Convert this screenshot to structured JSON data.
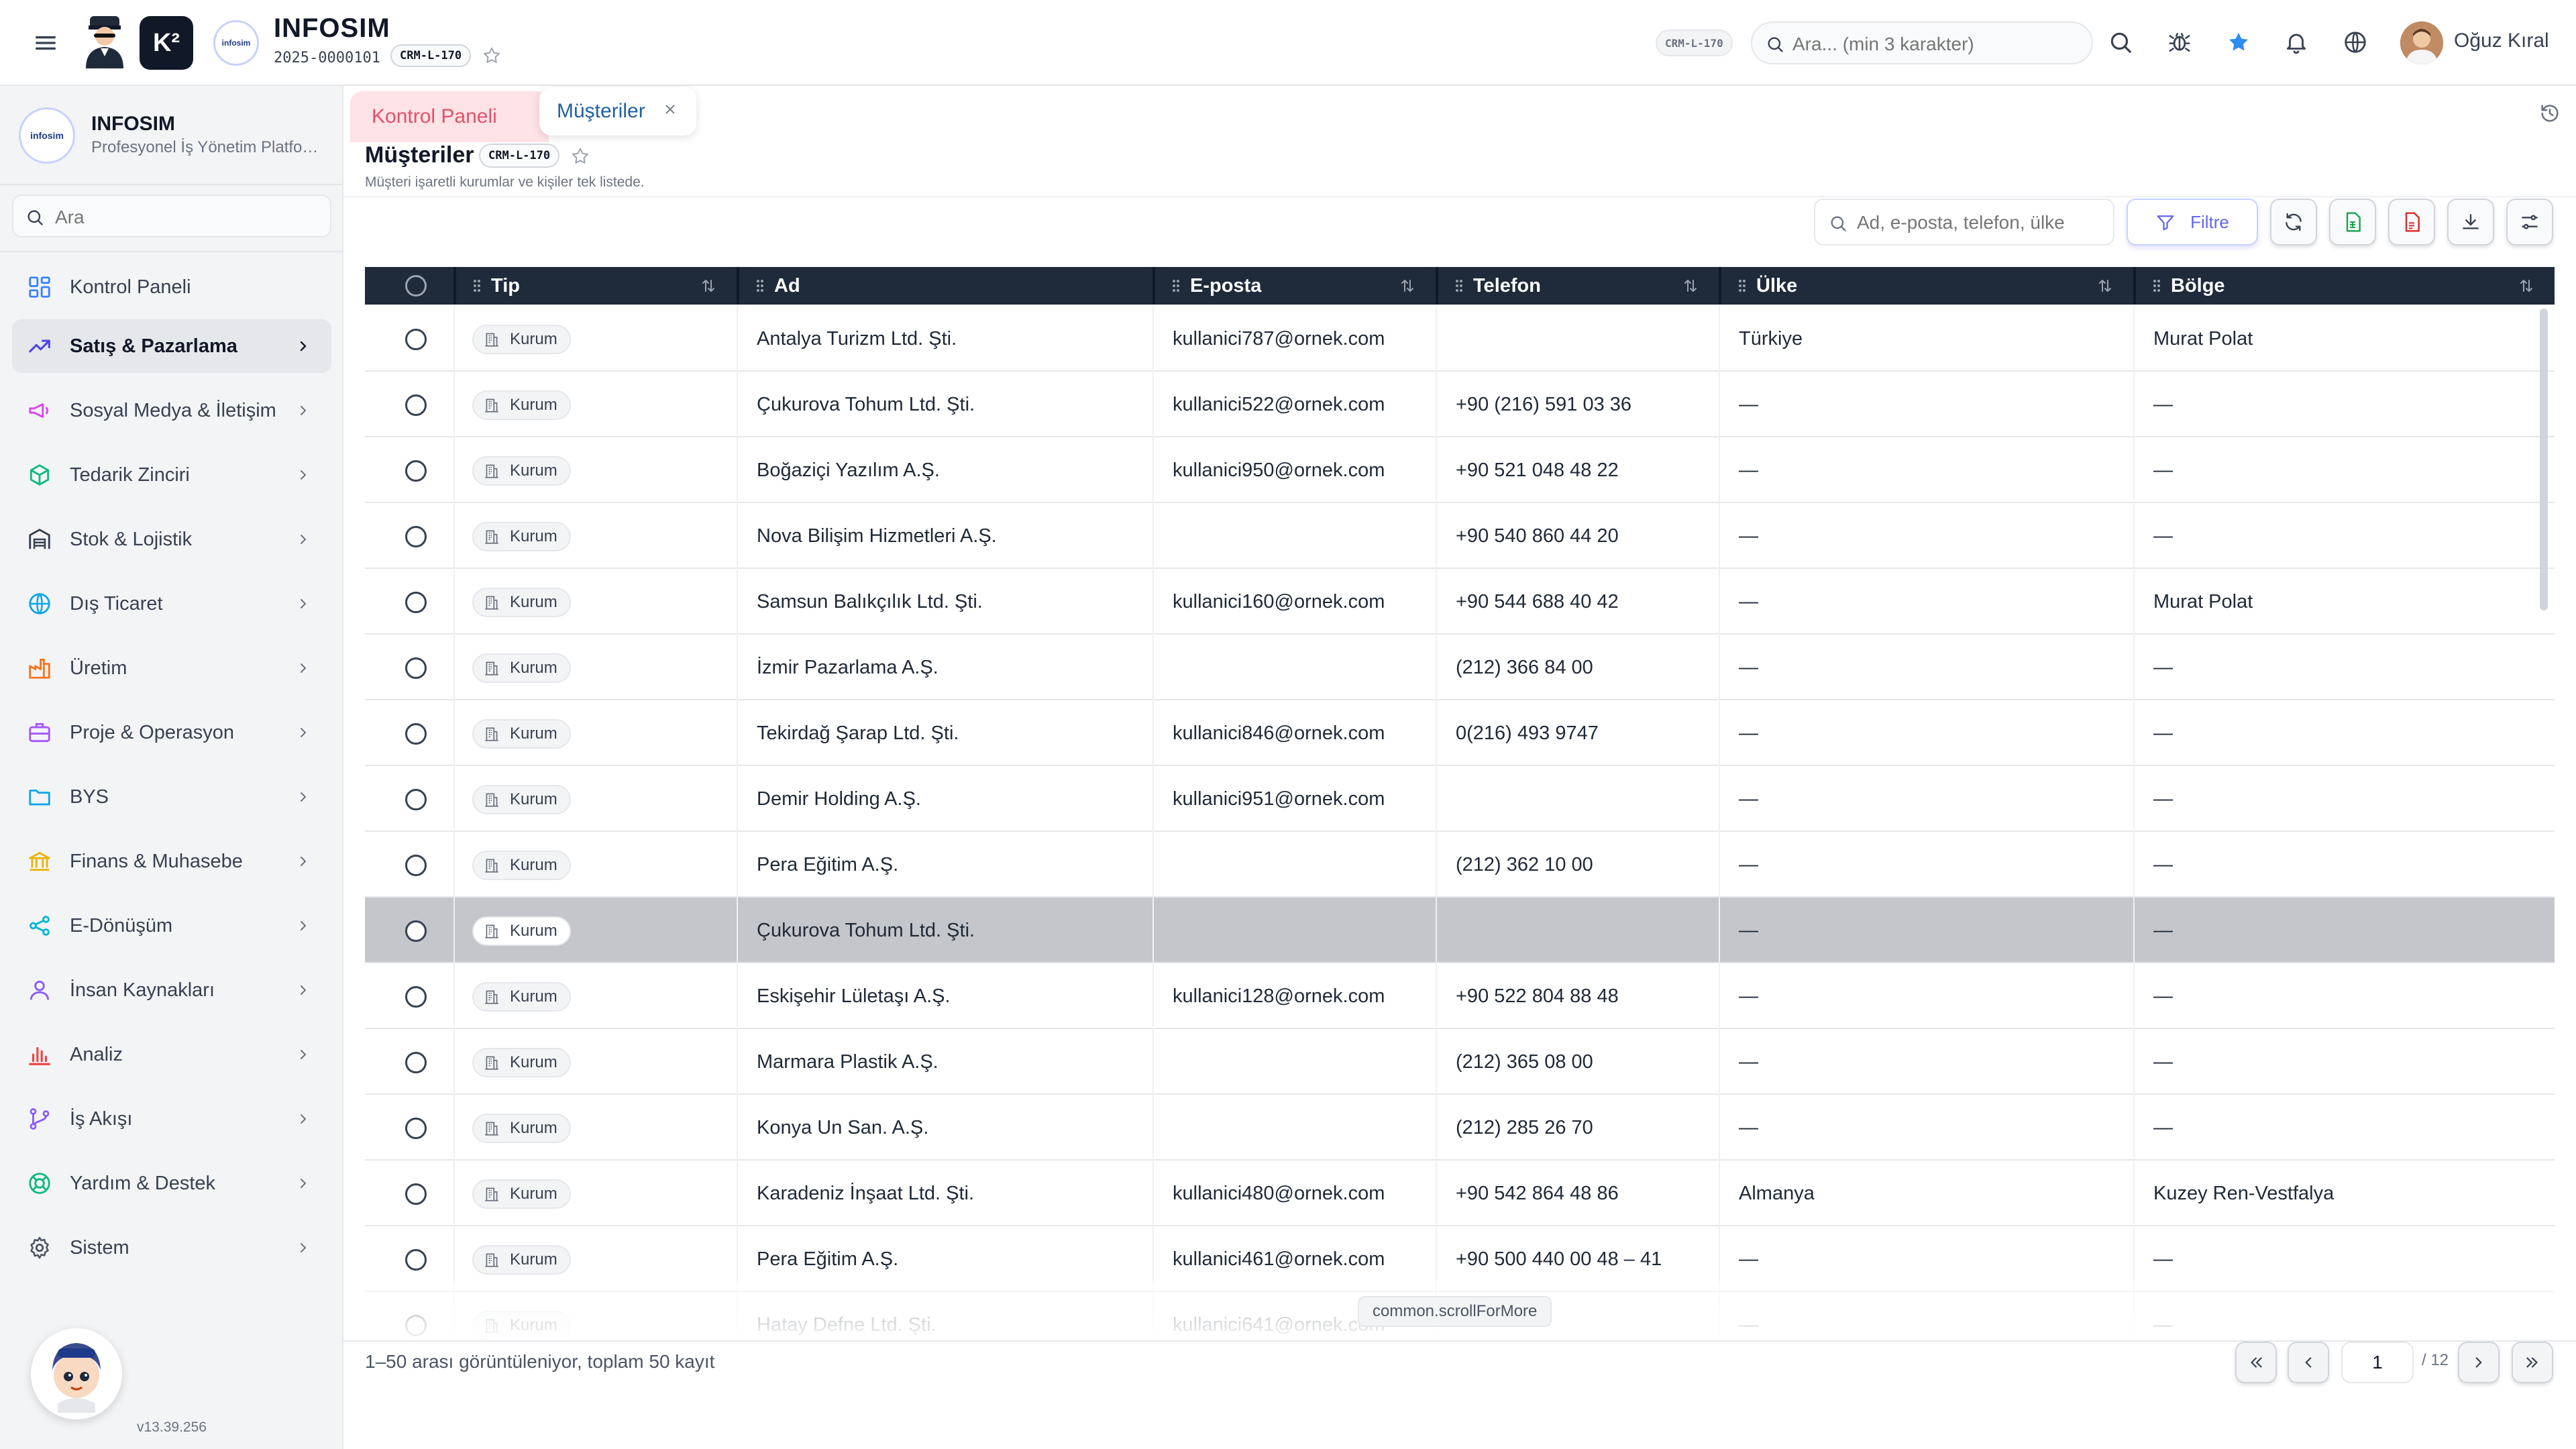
{
  "topbar": {
    "brand_title": "INFOSIM",
    "brand_code": "2025-0000101",
    "brand_chip": "CRM-L-170",
    "logo_text": "K²",
    "brand_circle_text": "infosim",
    "top_chip": "CRM-L-170",
    "search_placeholder": "Ara... (min 3 karakter)",
    "user_name": "Oğuz Kıral"
  },
  "sidebar": {
    "logo_text": "infosim",
    "title": "INFOSIM",
    "subtitle": "Profesyonel İş Yönetim Platformu",
    "search_placeholder": "Ara",
    "items": [
      {
        "label": "Kontrol Paneli",
        "icon": "dashboard-icon",
        "color": "#3b82f6"
      },
      {
        "label": "Satış & Pazarlama",
        "icon": "trending-up-icon",
        "color": "#4f46e5"
      },
      {
        "label": "Sosyal Medya & İletişim",
        "icon": "megaphone-icon",
        "color": "#d946ef"
      },
      {
        "label": "Tedarik Zinciri",
        "icon": "package-icon",
        "color": "#10b981"
      },
      {
        "label": "Stok & Lojistik",
        "icon": "warehouse-icon",
        "color": "#374151"
      },
      {
        "label": "Dış Ticaret",
        "icon": "globe-icon",
        "color": "#0ea5e9"
      },
      {
        "label": "Üretim",
        "icon": "factory-icon",
        "color": "#f97316"
      },
      {
        "label": "Proje & Operasyon",
        "icon": "briefcase-icon",
        "color": "#a855f7"
      },
      {
        "label": "BYS",
        "icon": "folder-icon",
        "color": "#0ea5e9"
      },
      {
        "label": "Finans & Muhasebe",
        "icon": "bank-icon",
        "color": "#eab308"
      },
      {
        "label": "E-Dönüşüm",
        "icon": "share-icon",
        "color": "#06b6d4"
      },
      {
        "label": "İnsan Kaynakları",
        "icon": "user-icon",
        "color": "#8b5cf6"
      },
      {
        "label": "Analiz",
        "icon": "bar-chart-icon",
        "color": "#ef4444"
      },
      {
        "label": "İş Akışı",
        "icon": "git-branch-icon",
        "color": "#8b5cf6"
      },
      {
        "label": "Yardım & Destek",
        "icon": "lifebuoy-icon",
        "color": "#10b981"
      },
      {
        "label": "Sistem",
        "icon": "settings-icon",
        "color": "#4b5563"
      }
    ],
    "version": "v13.39.256"
  },
  "tabs": [
    {
      "label": "Kontrol Paneli"
    },
    {
      "label": "Müşteriler"
    }
  ],
  "page": {
    "title": "Müşteriler",
    "chip": "CRM-L-170",
    "description": "Müşteri işaretli kurumlar ve kişiler tek listede."
  },
  "toolbar": {
    "search_placeholder": "Ad, e-posta, telefon, ülke",
    "filter_label": "Filtre"
  },
  "table": {
    "columns": [
      "Tip",
      "Ad",
      "E-posta",
      "Telefon",
      "Ülke",
      "Bölge"
    ],
    "rows": [
      {
        "tip": "Kurum",
        "ad": "Antalya Turizm Ltd. Şti.",
        "eposta": "kullanici787@ornek.com",
        "telefon": "",
        "ulke": "Türkiye",
        "bolge": "Murat Polat"
      },
      {
        "tip": "Kurum",
        "ad": "Çukurova Tohum Ltd. Şti.",
        "eposta": "kullanici522@ornek.com",
        "telefon": "+90 (216) 591 03 36",
        "ulke": "—",
        "bolge": "—"
      },
      {
        "tip": "Kurum",
        "ad": "Boğaziçi Yazılım A.Ş.",
        "eposta": "kullanici950@ornek.com",
        "telefon": "+90 521 048 48 22",
        "ulke": "—",
        "bolge": "—"
      },
      {
        "tip": "Kurum",
        "ad": "Nova Bilişim Hizmetleri A.Ş.",
        "eposta": "",
        "telefon": "+90 540 860 44 20",
        "ulke": "—",
        "bolge": "—"
      },
      {
        "tip": "Kurum",
        "ad": "Samsun Balıkçılık Ltd. Şti.",
        "eposta": "kullanici160@ornek.com",
        "telefon": "+90 544 688 40 42",
        "ulke": "—",
        "bolge": "Murat Polat"
      },
      {
        "tip": "Kurum",
        "ad": "İzmir Pazarlama A.Ş.",
        "eposta": "",
        "telefon": "(212) 366 84 00",
        "ulke": "—",
        "bolge": "—"
      },
      {
        "tip": "Kurum",
        "ad": "Tekirdağ Şarap Ltd. Şti.",
        "eposta": "kullanici846@ornek.com",
        "telefon": "0(216) 493 9747",
        "ulke": "—",
        "bolge": "—"
      },
      {
        "tip": "Kurum",
        "ad": "Demir Holding A.Ş.",
        "eposta": "kullanici951@ornek.com",
        "telefon": "",
        "ulke": "—",
        "bolge": "—"
      },
      {
        "tip": "Kurum",
        "ad": "Pera Eğitim A.Ş.",
        "eposta": "",
        "telefon": "(212) 362 10 00",
        "ulke": "—",
        "bolge": "—"
      },
      {
        "tip": "Kurum",
        "ad": "Çukurova Tohum Ltd. Şti.",
        "eposta": "",
        "telefon": "",
        "ulke": "—",
        "bolge": "—",
        "selected": true
      },
      {
        "tip": "Kurum",
        "ad": "Eskişehir Lületaşı A.Ş.",
        "eposta": "kullanici128@ornek.com",
        "telefon": "+90 522 804 88 48",
        "ulke": "—",
        "bolge": "—"
      },
      {
        "tip": "Kurum",
        "ad": "Marmara Plastik A.Ş.",
        "eposta": "",
        "telefon": "(212) 365 08 00",
        "ulke": "—",
        "bolge": "—"
      },
      {
        "tip": "Kurum",
        "ad": "Konya Un San. A.Ş.",
        "eposta": "",
        "telefon": "(212) 285 26 70",
        "ulke": "—",
        "bolge": "—"
      },
      {
        "tip": "Kurum",
        "ad": "Karadeniz İnşaat Ltd. Şti.",
        "eposta": "kullanici480@ornek.com",
        "telefon": "+90 542 864 48 86",
        "ulke": "Almanya",
        "bolge": "Kuzey Ren-Vestfalya"
      },
      {
        "tip": "Kurum",
        "ad": "Pera Eğitim A.Ş.",
        "eposta": "kullanici461@ornek.com",
        "telefon": "+90 500 440 00 48 – 41",
        "ulke": "—",
        "bolge": "—"
      },
      {
        "tip": "Kurum",
        "ad": "Hatay Defne Ltd. Şti.",
        "eposta": "kullanici641@ornek.com",
        "telefon": "",
        "ulke": "—",
        "bolge": "—"
      }
    ],
    "scroll_hint": "common.scrollForMore"
  },
  "footer": {
    "range_text": "1–50 arası görüntüleniyor, toplam 50 kayıt",
    "page_value": "1",
    "page_total": "/ 12"
  },
  "colors": {
    "header_bg": "#1f2a3a",
    "accent": "#6366f1",
    "tab_inactive_bg": "#fde2e6",
    "selected_row": "#c4c6cb"
  }
}
